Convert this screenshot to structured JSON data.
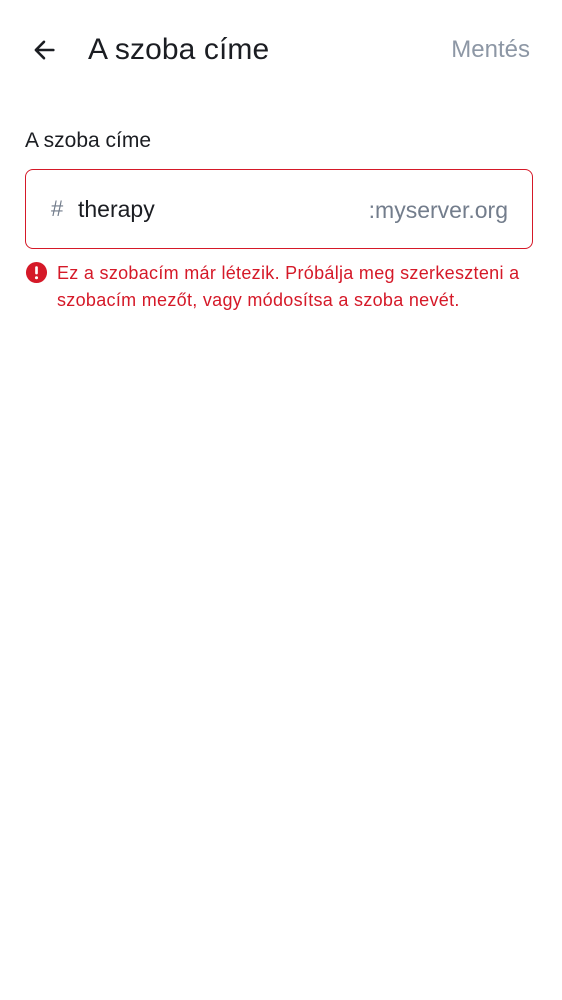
{
  "header": {
    "title": "A szoba címe",
    "save_label": "Mentés"
  },
  "field": {
    "label": "A szoba címe",
    "prefix": "#",
    "value": "therapy",
    "suffix": ":myserver.org"
  },
  "error": {
    "message": "Ez a szobacím már létezik. Próbálja meg szerkeszteni a szobacím mezőt, vagy módosítsa a szoba nevét."
  },
  "icons": {
    "back": "arrow-left-icon",
    "error": "error-icon"
  },
  "colors": {
    "error": "#d51928",
    "disabled_action": "#8d97a5",
    "secondary_text": "#737d8c",
    "primary_text": "#1b1d22"
  }
}
